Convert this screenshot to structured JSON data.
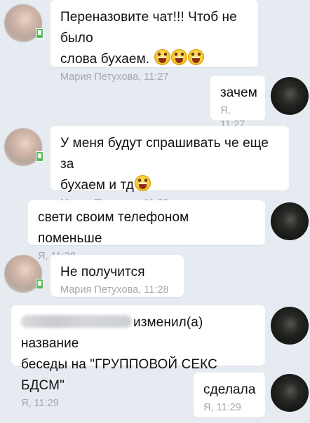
{
  "messages": [
    {
      "text_lines": [
        "Переназовите чат!!! Чтоб не было",
        "слова бухаем."
      ],
      "emoji": [
        "laughing-emoji",
        "laughing-emoji",
        "laughing-emoji"
      ],
      "author": "Мария Петухова",
      "time": "11:27"
    },
    {
      "text": "зачем",
      "author": "Я",
      "time": "11:27"
    },
    {
      "text_lines": [
        "У меня будут спрашивать че еще за",
        "бухаем и тд"
      ],
      "emoji": [
        "laughing-emoji"
      ],
      "author": "Мария Петухова",
      "time": "11:28"
    },
    {
      "text": "свети своим телефоном поменьше",
      "author": "Я",
      "time": "11:28"
    },
    {
      "text": "Не получится",
      "author": "Мария Петухова",
      "time": "11:28"
    },
    {
      "text_lines": [
        "изменил(а) название",
        "беседы на \"ГРУППОВОЙ СЕКС БДСМ\""
      ],
      "author": "Я",
      "time": "11:29"
    },
    {
      "text": "сделала",
      "author": "Я",
      "time": "11:29"
    }
  ],
  "colors": {
    "background": "#e5ebf1",
    "bubble": "#ffffff",
    "meta_text": "#a3a8ae",
    "mobile_badge": "#5cb85c"
  }
}
